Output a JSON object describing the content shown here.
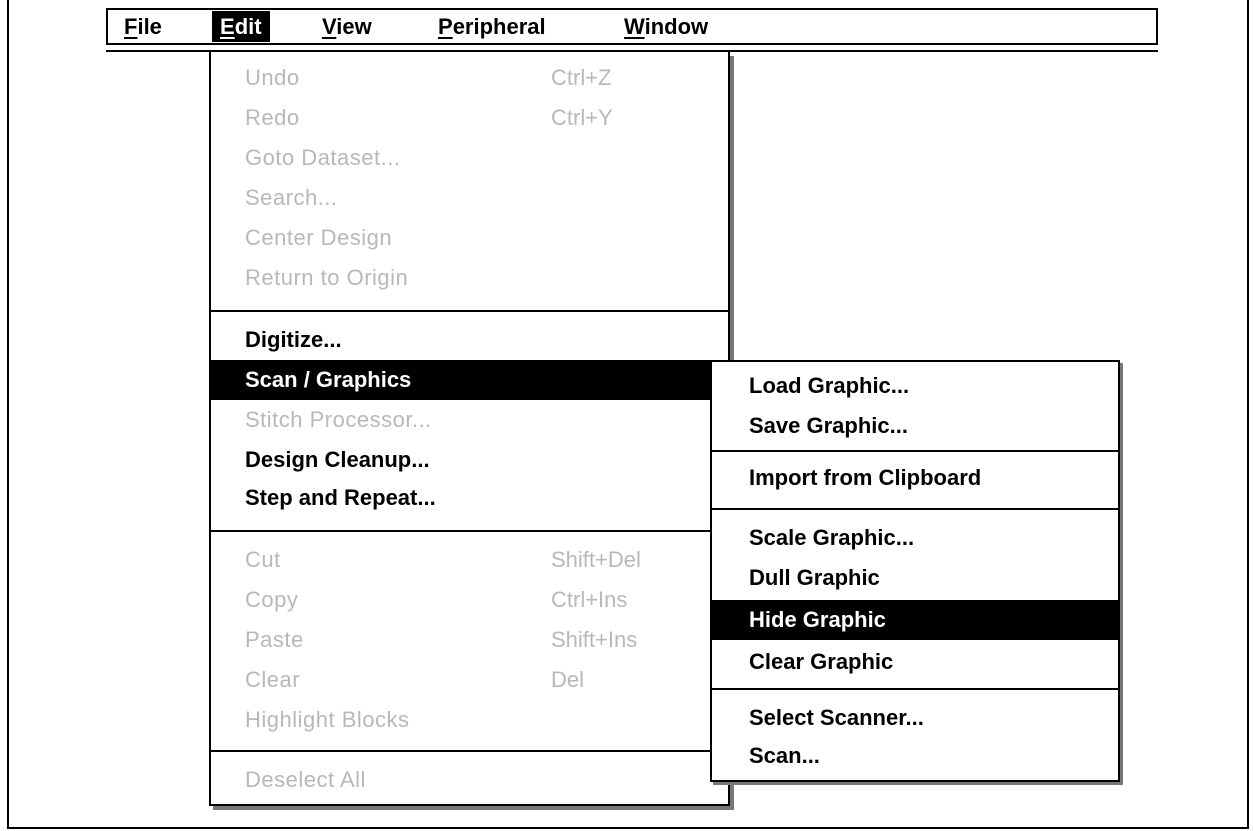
{
  "menubar": {
    "items": [
      {
        "label": "File",
        "u": "F",
        "rest": "ile"
      },
      {
        "label": "Edit",
        "u": "E",
        "rest": "dit"
      },
      {
        "label": "View",
        "u": "V",
        "rest": "iew"
      },
      {
        "label": "Peripheral",
        "u": "P",
        "rest": "eripheral"
      },
      {
        "label": "Window",
        "u": "W",
        "rest": "indow"
      }
    ]
  },
  "edit_menu": {
    "items": [
      {
        "label": "Undo",
        "shortcut": "Ctrl+Z",
        "disabled": true
      },
      {
        "label": "Redo",
        "shortcut": "Ctrl+Y",
        "disabled": true
      },
      {
        "label": "Goto Dataset...",
        "disabled": true
      },
      {
        "label": "Search...",
        "disabled": true
      },
      {
        "label": "Center Design",
        "disabled": true
      },
      {
        "label": "Return to Origin",
        "disabled": true
      },
      {
        "label": "Digitize...",
        "disabled": false
      },
      {
        "label": "Scan / Graphics",
        "disabled": false,
        "highlighted": true
      },
      {
        "label": "Stitch Processor...",
        "disabled": true
      },
      {
        "label": "Design Cleanup...",
        "disabled": false
      },
      {
        "label": "Step and Repeat...",
        "disabled": false
      },
      {
        "label": "Cut",
        "shortcut": "Shift+Del",
        "disabled": true
      },
      {
        "label": "Copy",
        "shortcut": "Ctrl+Ins",
        "disabled": true
      },
      {
        "label": "Paste",
        "shortcut": "Shift+Ins",
        "disabled": true
      },
      {
        "label": "Clear",
        "shortcut": "Del",
        "disabled": true
      },
      {
        "label": "Highlight Blocks",
        "disabled": true
      },
      {
        "label": "Deselect All",
        "disabled": true
      }
    ]
  },
  "graphics_submenu": {
    "items": [
      {
        "label": "Load Graphic..."
      },
      {
        "label": "Save Graphic..."
      },
      {
        "label": "Import from Clipboard"
      },
      {
        "label": "Scale Graphic..."
      },
      {
        "label": "Dull Graphic"
      },
      {
        "label": "Hide Graphic",
        "highlighted": true
      },
      {
        "label": "Clear Graphic"
      },
      {
        "label": "Select Scanner..."
      },
      {
        "label": "Scan..."
      }
    ]
  }
}
